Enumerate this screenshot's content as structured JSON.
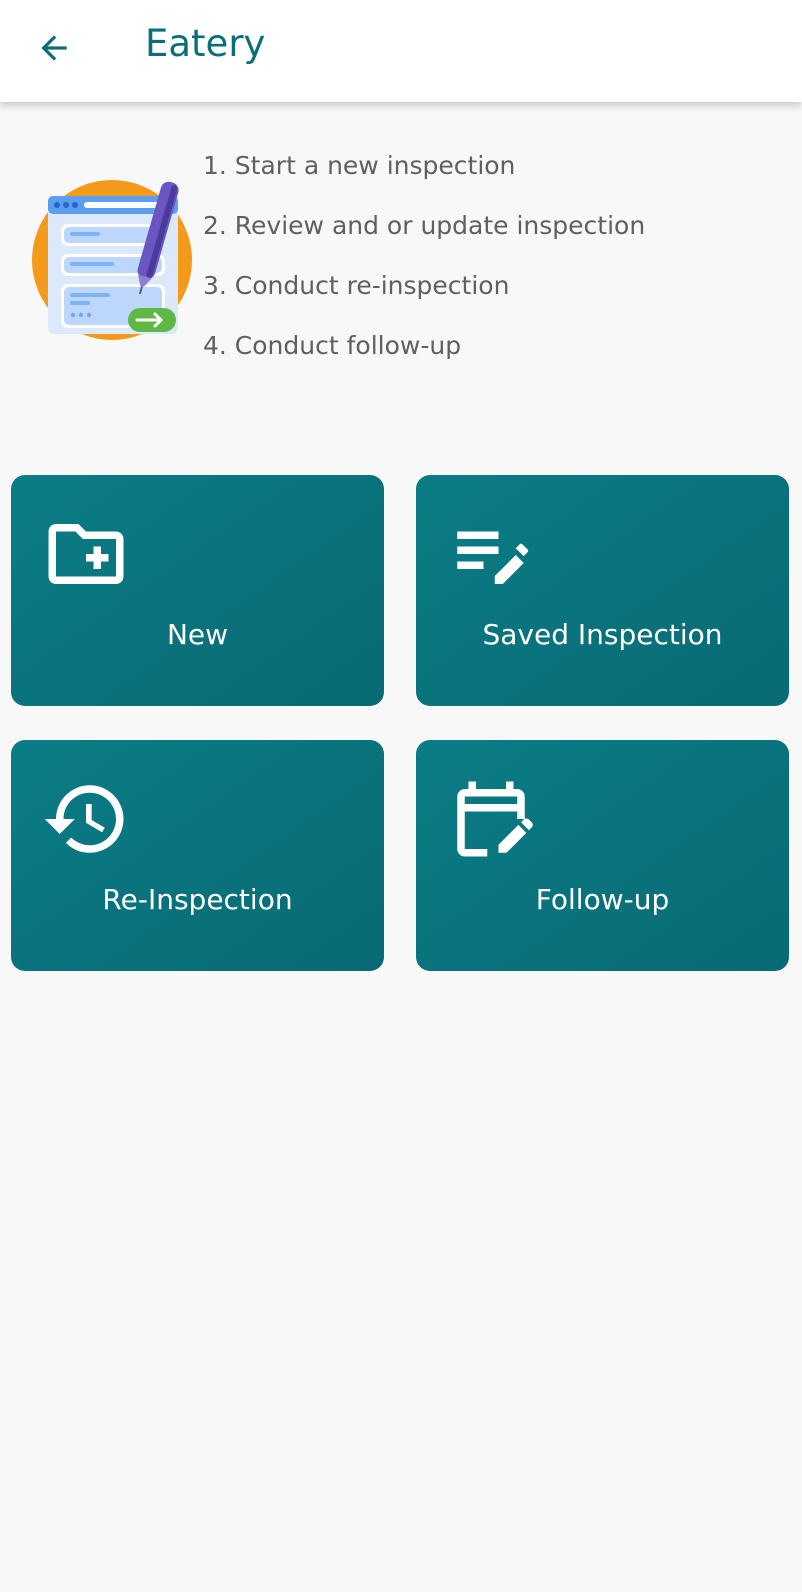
{
  "header": {
    "title": "Eatery",
    "back_icon": "arrow-back-icon"
  },
  "hero": {
    "illustration": "inspection-form-illustration",
    "steps": [
      "1. Start a new inspection",
      "2. Review and or update inspection",
      "3. Conduct re-inspection",
      "4. Conduct follow-up"
    ]
  },
  "actions": [
    {
      "label": "New",
      "icon": "folder-add-icon"
    },
    {
      "label": "Saved Inspection",
      "icon": "edit-list-icon"
    },
    {
      "label": "Re-Inspection",
      "icon": "history-icon"
    },
    {
      "label": "Follow-up",
      "icon": "calendar-edit-icon"
    }
  ],
  "colors": {
    "primary": "#0b7680",
    "title": "#0b6e78",
    "background": "#f8f8f8",
    "step_text": "#5f5f5f"
  }
}
